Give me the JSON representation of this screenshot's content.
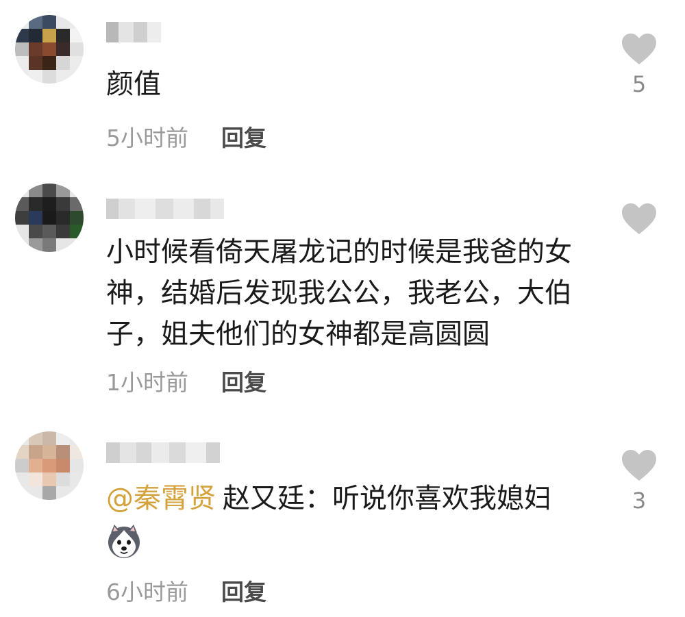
{
  "comments": [
    {
      "text": "颜值",
      "time": "5小时前",
      "reply": "回复",
      "likes": "5"
    },
    {
      "text": "小时候看倚天屠龙记的时候是我爸的女神，结婚后发现我公公，我老公，大伯子，姐夫他们的女神都是高圆圆",
      "time": "1小时前",
      "reply": "回复",
      "likes": ""
    },
    {
      "mention": "@秦霄贤",
      "text": "赵又廷：听说你喜欢我媳妇",
      "sticker": "husky-dog-emoji",
      "time": "6小时前",
      "reply": "回复",
      "likes": "3"
    }
  ],
  "colors": {
    "mention": "#d4a23c",
    "heart": "#c4c4c4",
    "meta": "#9a9a9a",
    "text": "#1a1a1a"
  },
  "icons": {
    "like": "heart-icon"
  }
}
